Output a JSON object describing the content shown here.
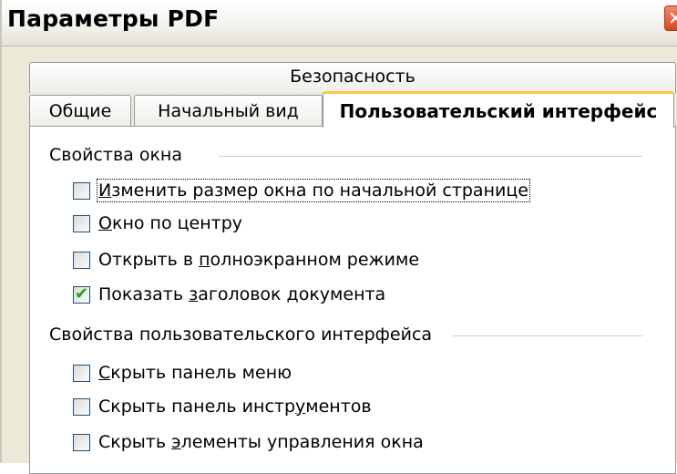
{
  "window": {
    "title": "Параметры PDF"
  },
  "tabs": {
    "row_top": "Безопасность",
    "general": "Общие",
    "initial_view": "Начальный вид",
    "user_interface": "Пользовательский интерфейс"
  },
  "window_options": {
    "heading": "Свойства окна",
    "items": [
      {
        "pre": "",
        "mnemonic": "И",
        "post": "зменить размер окна по начальной странице",
        "checked": false
      },
      {
        "pre": "",
        "mnemonic": "О",
        "post": "кно по центру",
        "checked": false
      },
      {
        "pre": "Открыть в ",
        "mnemonic": "п",
        "post": "олноэкранном режиме",
        "checked": false
      },
      {
        "pre": "Показать ",
        "mnemonic": "з",
        "post": "аголовок документа",
        "checked": true
      }
    ]
  },
  "ui_options": {
    "heading": "Свойства пользовательского интерфейса",
    "items": [
      {
        "pre": "",
        "mnemonic": "С",
        "post": "крыть панель меню",
        "checked": false
      },
      {
        "pre": "Скрыть панель инстр",
        "mnemonic": "у",
        "post": "ментов",
        "checked": false
      },
      {
        "pre": "Скрыть ",
        "mnemonic": "э",
        "post": "лементы управления окна",
        "checked": false
      }
    ]
  },
  "colors": {
    "tab_highlight": "#ffc83c",
    "check": "#21a121",
    "checkbox_border": "#1c5180"
  }
}
